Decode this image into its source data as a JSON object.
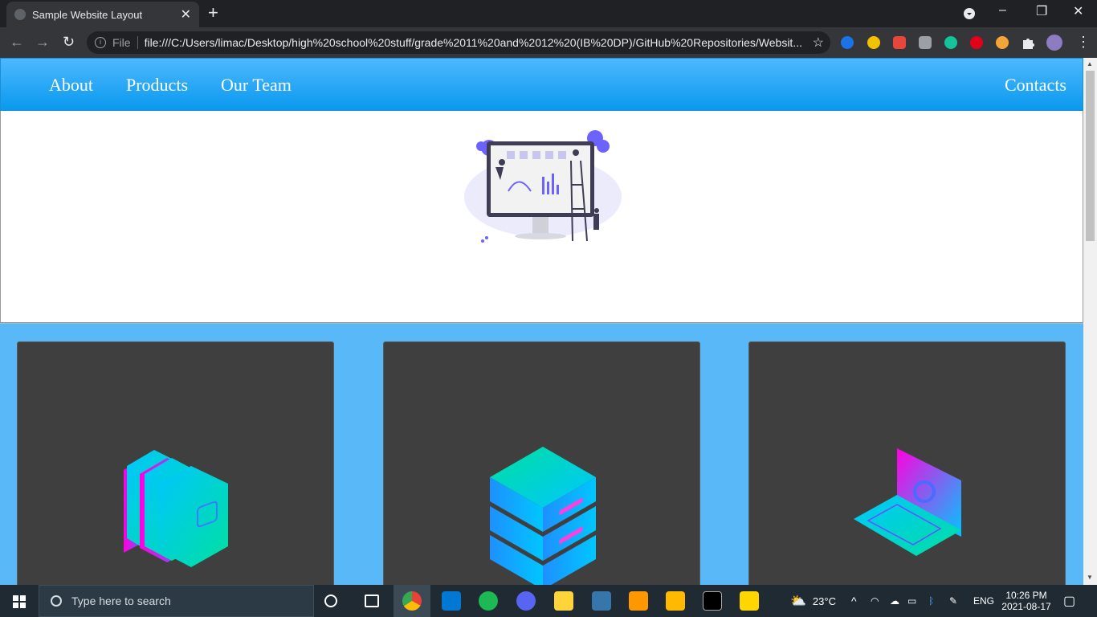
{
  "browser": {
    "tab_title": "Sample Website Layout",
    "tab_close": "✕",
    "new_tab": "+",
    "address": {
      "scheme_label": "File",
      "url": "file:///C:/Users/limac/Desktop/high%20school%20stuff/grade%2011%20and%2012%20(IB%20DP)/GitHub%20Repositories/Websit..."
    },
    "window_controls": [
      "–",
      "❐",
      "✕"
    ]
  },
  "site": {
    "nav": {
      "links": [
        "About",
        "Products",
        "Our Team"
      ],
      "contacts": "Contacts"
    },
    "colors": {
      "nav_gradient_top": "#4db8ff",
      "nav_gradient_bottom": "#0a99ee",
      "cards_bg": "#58b8f8",
      "card_bg": "#3f3f3f"
    },
    "hero_image": "dashboard-illustration",
    "cards": [
      {
        "icon": "folders-icon"
      },
      {
        "icon": "server-stack-icon"
      },
      {
        "icon": "laptop-gear-icon"
      }
    ]
  },
  "taskbar": {
    "search_placeholder": "Type here to search",
    "weather": "23°C",
    "language": "ENG",
    "time": "10:26 PM",
    "date": "2021-08-17"
  }
}
